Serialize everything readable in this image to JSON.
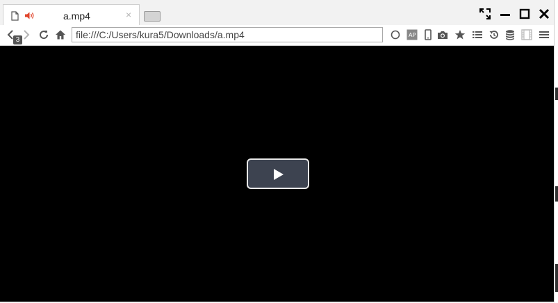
{
  "tab": {
    "title": "a.mp4",
    "close_label": "×"
  },
  "navigation": {
    "history_count": "3"
  },
  "address_bar": {
    "url": "file:///C:/Users/kura5/Downloads/a.mp4"
  },
  "icons": {
    "tab": [
      "file-icon",
      "audio-playing-icon",
      "close-icon"
    ],
    "window": [
      "fullscreen-icon",
      "minimize-icon",
      "maximize-icon",
      "close-icon"
    ],
    "toolbar": [
      "back-icon",
      "forward-icon",
      "reload-icon",
      "home-icon",
      "circle-icon",
      "translate-icon",
      "mobile-icon",
      "camera-icon",
      "star-icon",
      "list-icon",
      "history-icon",
      "database-icon",
      "film-icon",
      "menu-icon"
    ],
    "video": [
      "play-icon"
    ]
  },
  "colors": {
    "audio_icon": "#e0442b",
    "play_button": "#3d4350",
    "video_background": "#000000"
  }
}
